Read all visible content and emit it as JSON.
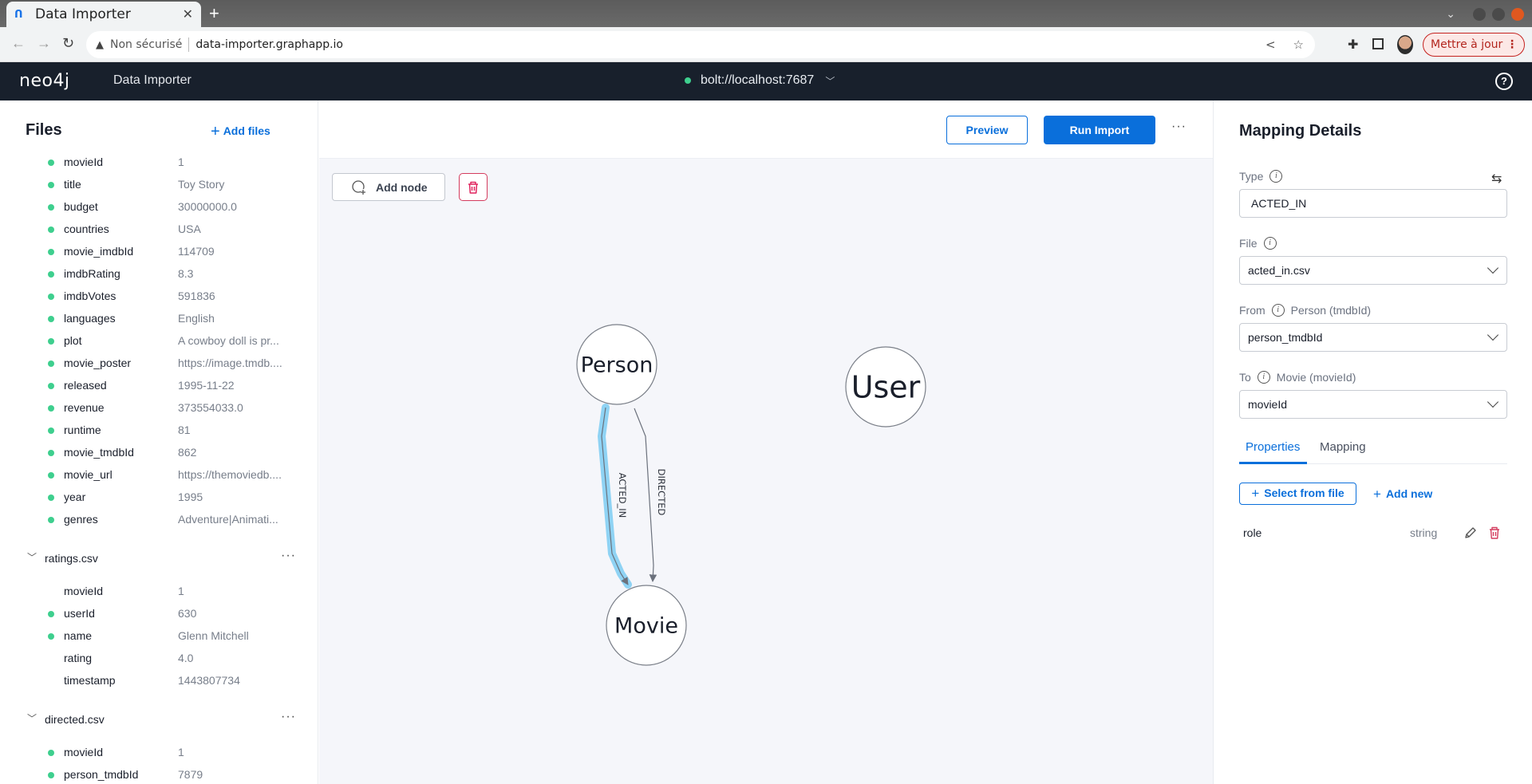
{
  "browser": {
    "tab_title": "Data Importer",
    "new_tab": "+",
    "security_label": "Non sécurisé",
    "url": "data-importer.graphapp.io",
    "update_button": "Mettre à jour"
  },
  "header": {
    "logo": "neo4j",
    "app_name": "Data Importer",
    "connection": "bolt://localhost:7687",
    "connection_status_color": "#3ecf8e"
  },
  "files_panel": {
    "title": "Files",
    "add_files_label": "Add files",
    "groups": [
      {
        "name": "",
        "fields": [
          {
            "key": "movieId",
            "value": "1",
            "mapped": true
          },
          {
            "key": "title",
            "value": "Toy Story",
            "mapped": true
          },
          {
            "key": "budget",
            "value": "30000000.0",
            "mapped": true
          },
          {
            "key": "countries",
            "value": "USA",
            "mapped": true
          },
          {
            "key": "movie_imdbId",
            "value": "114709",
            "mapped": true
          },
          {
            "key": "imdbRating",
            "value": "8.3",
            "mapped": true
          },
          {
            "key": "imdbVotes",
            "value": "591836",
            "mapped": true
          },
          {
            "key": "languages",
            "value": "English",
            "mapped": true
          },
          {
            "key": "plot",
            "value": "A cowboy doll is pr...",
            "mapped": true
          },
          {
            "key": "movie_poster",
            "value": "https://image.tmdb....",
            "mapped": true
          },
          {
            "key": "released",
            "value": "1995-11-22",
            "mapped": true
          },
          {
            "key": "revenue",
            "value": "373554033.0",
            "mapped": true
          },
          {
            "key": "runtime",
            "value": "81",
            "mapped": true
          },
          {
            "key": "movie_tmdbId",
            "value": "862",
            "mapped": true
          },
          {
            "key": "movie_url",
            "value": "https://themoviedb....",
            "mapped": true
          },
          {
            "key": "year",
            "value": "1995",
            "mapped": true
          },
          {
            "key": "genres",
            "value": "Adventure|Animati...",
            "mapped": true
          }
        ]
      },
      {
        "name": "ratings.csv",
        "fields": [
          {
            "key": "movieId",
            "value": "1",
            "mapped": false
          },
          {
            "key": "userId",
            "value": "630",
            "mapped": true
          },
          {
            "key": "name",
            "value": "Glenn Mitchell",
            "mapped": true
          },
          {
            "key": "rating",
            "value": "4.0",
            "mapped": false
          },
          {
            "key": "timestamp",
            "value": "1443807734",
            "mapped": false
          }
        ]
      },
      {
        "name": "directed.csv",
        "fields": [
          {
            "key": "movieId",
            "value": "1",
            "mapped": true
          },
          {
            "key": "person_tmdbId",
            "value": "7879",
            "mapped": true
          }
        ]
      }
    ]
  },
  "canvas": {
    "preview_label": "Preview",
    "run_import_label": "Run Import",
    "more_label": "···",
    "add_node_label": "Add node",
    "nodes": [
      {
        "id": "person",
        "label": "Person"
      },
      {
        "id": "movie",
        "label": "Movie"
      },
      {
        "id": "user",
        "label": "User"
      }
    ],
    "relationships": [
      {
        "type": "ACTED_IN",
        "from": "person",
        "to": "movie",
        "selected": true
      },
      {
        "type": "DIRECTED",
        "from": "person",
        "to": "movie",
        "selected": false
      }
    ],
    "highlight_color": "#8fd3f4"
  },
  "mapping": {
    "title": "Mapping Details",
    "type_label": "Type",
    "type_value": "ACTED_IN",
    "file_label": "File",
    "file_value": "acted_in.csv",
    "from_label": "From",
    "from_node": "Person (tmdbId)",
    "from_value": "person_tmdbId",
    "to_label": "To",
    "to_node": "Movie (movieId)",
    "to_value": "movieId",
    "tabs": [
      {
        "label": "Properties",
        "active": true
      },
      {
        "label": "Mapping",
        "active": false
      }
    ],
    "select_from_file_label": "Select from file",
    "add_new_label": "Add new",
    "properties": [
      {
        "name": "role",
        "type": "string"
      }
    ]
  }
}
